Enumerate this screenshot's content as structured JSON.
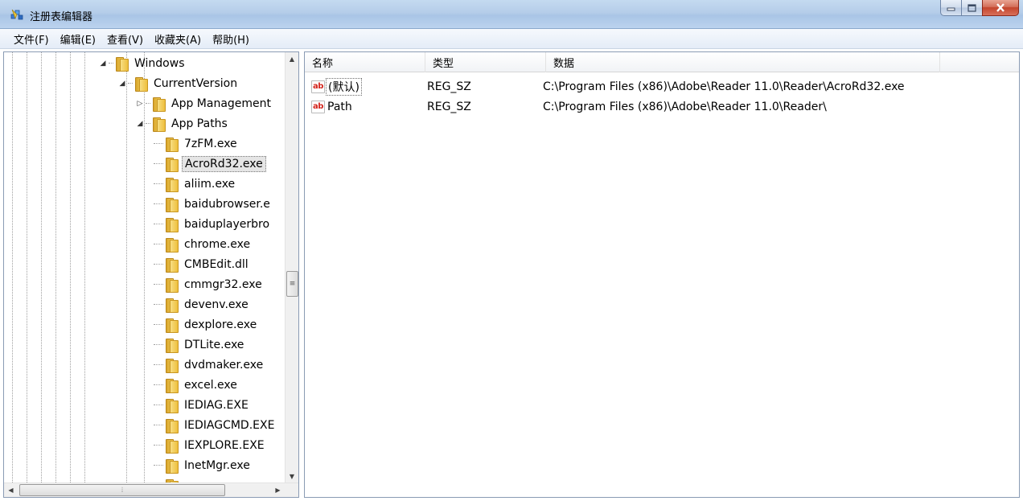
{
  "window": {
    "title": "注册表编辑器",
    "icon": "regedit-icon"
  },
  "menu": [
    "文件(F)",
    "编辑(E)",
    "查看(V)",
    "收藏夹(A)",
    "帮助(H)"
  ],
  "tree": {
    "nodes": [
      {
        "label": "Windows",
        "expander": "expanded"
      },
      {
        "label": "CurrentVersion",
        "expander": "expanded"
      },
      {
        "label": "App Management",
        "expander": "collapsed"
      },
      {
        "label": "App Paths",
        "expander": "expanded"
      },
      {
        "label": "7zFM.exe"
      },
      {
        "label": "AcroRd32.exe",
        "selected": true
      },
      {
        "label": "aliim.exe"
      },
      {
        "label": "baidubrowser.e"
      },
      {
        "label": "baiduplayerbro"
      },
      {
        "label": "chrome.exe"
      },
      {
        "label": "CMBEdit.dll"
      },
      {
        "label": "cmmgr32.exe"
      },
      {
        "label": "devenv.exe"
      },
      {
        "label": "dexplore.exe"
      },
      {
        "label": "DTLite.exe"
      },
      {
        "label": "dvdmaker.exe"
      },
      {
        "label": "excel.exe"
      },
      {
        "label": "IEDIAG.EXE"
      },
      {
        "label": "IEDIAGCMD.EXE"
      },
      {
        "label": "IEXPLORE.EXE"
      },
      {
        "label": "InetMgr.exe"
      }
    ]
  },
  "list": {
    "columns": [
      "名称",
      "类型",
      "数据"
    ],
    "rows": [
      {
        "icon": "ab",
        "name": "(默认)",
        "type": "REG_SZ",
        "data": "C:\\Program Files (x86)\\Adobe\\Reader 11.0\\Reader\\AcroRd32.exe"
      },
      {
        "icon": "ab",
        "name": "Path",
        "type": "REG_SZ",
        "data": "C:\\Program Files (x86)\\Adobe\\Reader 11.0\\Reader\\"
      }
    ]
  }
}
